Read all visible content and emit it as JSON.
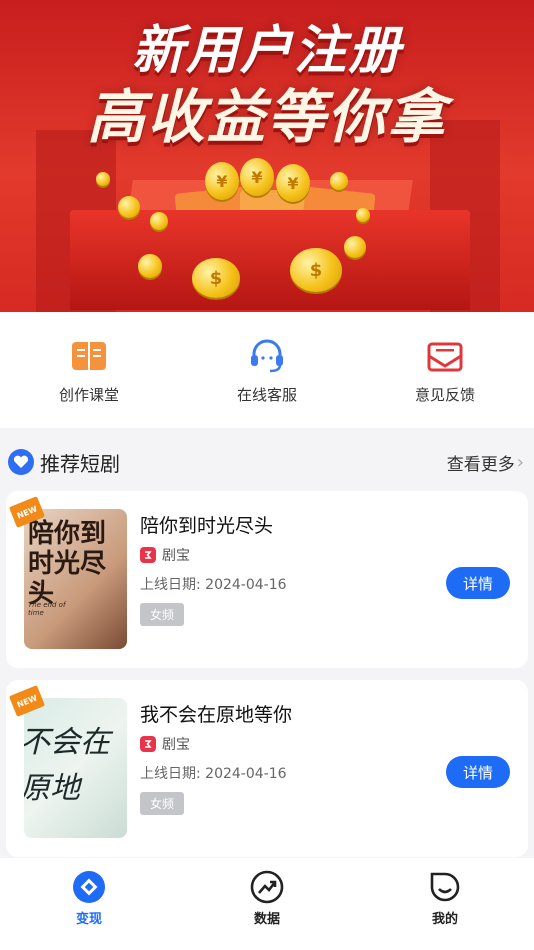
{
  "banner": {
    "line1": "新用户注册",
    "line2": "高收益等你拿",
    "coin_symbol": "¥",
    "dollar_symbol": "$"
  },
  "quick_menu": [
    {
      "label": "创作课堂",
      "icon": "book-icon"
    },
    {
      "label": "在线客服",
      "icon": "headset-icon"
    },
    {
      "label": "意见反馈",
      "icon": "mail-icon"
    }
  ],
  "section": {
    "title": "推荐短剧",
    "more_label": "查看更多",
    "chevron": "›"
  },
  "dramas": [
    {
      "title": "陪你到时光尽头",
      "platform": "剧宝",
      "date": "上线日期: 2024-04-16",
      "tag": "女频",
      "button": "详情",
      "badge": "NEW",
      "cover_text": "陪你到时光尽头",
      "cover_sub": "The end of time"
    },
    {
      "title": "我不会在原地等你",
      "platform": "剧宝",
      "date": "上线日期: 2024-04-16",
      "tag": "女频",
      "button": "详情",
      "badge": "NEW",
      "cover_text": "不会在原地"
    }
  ],
  "tabs": [
    {
      "label": "变现",
      "icon": "monetize-icon",
      "active": true
    },
    {
      "label": "数据",
      "icon": "trend-icon",
      "active": false
    },
    {
      "label": "我的",
      "icon": "profile-icon",
      "active": false
    }
  ],
  "colors": {
    "accent": "#1e6cf5",
    "banner_red": "#d62a22",
    "tag_gray": "#c3c5c9",
    "badge_orange": "#f28a18",
    "platform_red": "#e8344b"
  }
}
